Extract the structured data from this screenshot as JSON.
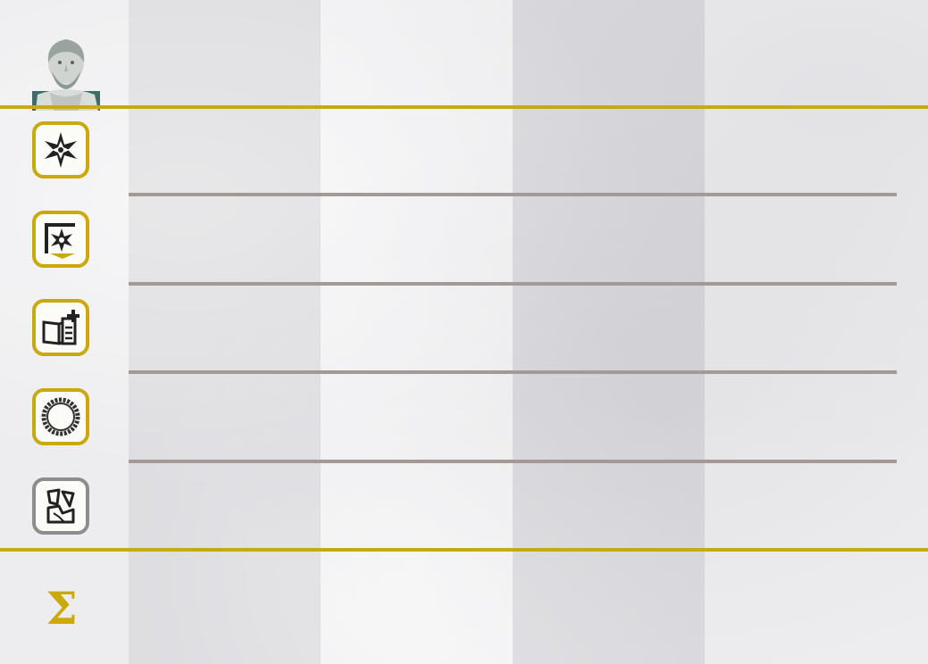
{
  "board": {
    "header_icon": "philosopher-bust-icon",
    "rows": [
      {
        "id": "wonder",
        "icon": "star-burst-icon",
        "border_color": "#c9a90e"
      },
      {
        "id": "progress",
        "icon": "star-banner-icon",
        "border_color": "#c9a90e"
      },
      {
        "id": "science",
        "icon": "book-plus-icon",
        "border_color": "#c9a90e"
      },
      {
        "id": "coins",
        "icon": "coin-ring-icon",
        "border_color": "#c9a90e"
      },
      {
        "id": "conflict",
        "icon": "broken-tablet-icon",
        "border_color": "#8d8d8d"
      }
    ],
    "total_symbol": "Σ",
    "player_columns": 4,
    "colors": {
      "accent_gold": "#c9a90e",
      "divider_grey": "#a39a98",
      "tile_grey": "#8d8d8d"
    }
  }
}
